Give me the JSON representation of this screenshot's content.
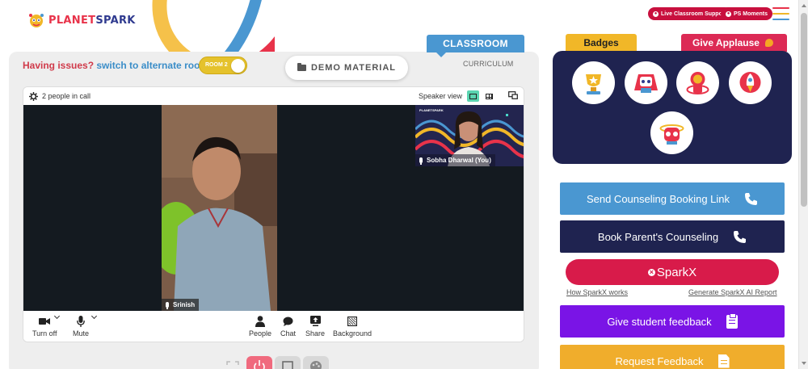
{
  "brand": {
    "logo_part1": "PLANET",
    "logo_part2": "SPARK"
  },
  "header": {
    "live_support_label": "Live Classroom Support",
    "ps_moments_label": "PS Moments",
    "menu_icon": "hamburger-icon",
    "colors": {
      "pill": "#c8103e",
      "menu_lines": [
        "#e8334a",
        "#f1b728",
        "#4a97d1"
      ]
    }
  },
  "classroom": {
    "tab_classroom": "CLASSROOM",
    "tab_curriculum": "CURRICULUM",
    "issues_question": "Having issues?",
    "issues_link": "switch to alternate room",
    "room_toggle_label": "ROOM 2",
    "demo_material_label": "DEMO MATERIAL"
  },
  "call": {
    "people_count": "2 people in call",
    "speaker_view_label": "Speaker view",
    "main_participant": "Srinish",
    "self_participant": "Sobha Dharwal (You)",
    "self_video_brand": "PLANETSPARK",
    "controls": [
      {
        "label": "Turn off",
        "icon": "camera-icon"
      },
      {
        "label": "Mute",
        "icon": "mic-icon"
      },
      {
        "label": "People",
        "icon": "people-icon"
      },
      {
        "label": "Chat",
        "icon": "chat-icon"
      },
      {
        "label": "Share",
        "icon": "share-screen-icon"
      },
      {
        "label": "Background",
        "icon": "background-icon"
      }
    ]
  },
  "bottom_controls": [
    {
      "icon": "fullscreen-icon"
    },
    {
      "icon": "power-icon",
      "color": "#f06a7e"
    },
    {
      "icon": "square-icon"
    },
    {
      "icon": "palette-icon"
    }
  ],
  "badges": {
    "tab_label": "Badges",
    "applause_label": "Give Applause",
    "items": [
      {
        "icon": "trophy-badge-icon"
      },
      {
        "icon": "robot-badge-icon"
      },
      {
        "icon": "astronaut-badge-icon"
      },
      {
        "icon": "rocket-badge-icon"
      },
      {
        "icon": "scientist-badge-icon"
      }
    ]
  },
  "actions": {
    "counseling_link": "Send Counseling Booking Link",
    "parent_counseling": "Book Parent's Counseling",
    "sparkx_label": "SparkX",
    "how_sparkx": "How SparkX works",
    "generate_sparkx": "Generate SparkX AI Report",
    "student_feedback": "Give student feedback",
    "request_feedback": "Request Feedback",
    "colors": {
      "counseling_link": "#4a97d1",
      "parent_counseling": "#1f2350",
      "sparkx": "#d81b4a",
      "student_feedback": "#7a14e6",
      "request_feedback": "#f0ad2c"
    }
  }
}
